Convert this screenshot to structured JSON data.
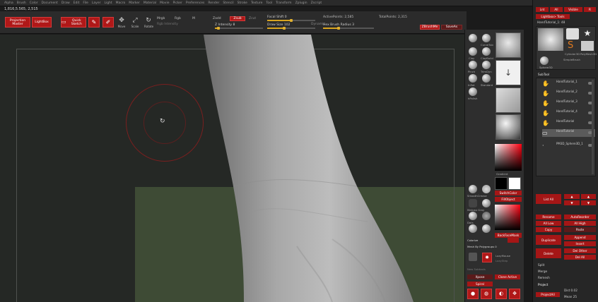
{
  "menu": [
    "Alpha",
    "Brush",
    "Color",
    "Document",
    "Draw",
    "Edit",
    "File",
    "Layer",
    "Light",
    "Macro",
    "Marker",
    "Material",
    "Movie",
    "Picker",
    "Preferences",
    "Render",
    "Stencil",
    "Stroke",
    "Texture",
    "Tool",
    "Transform",
    "Zplugin",
    "Zscript"
  ],
  "status_line": "1,816,5.565, 2,515",
  "shelf": {
    "projection_master": "Projection Master",
    "lightbox": "LightBox",
    "quick_sketch": "Quick Sketch",
    "edit": "Edit",
    "draw": "Draw",
    "move": "Move",
    "scale": "Scale",
    "rotate": "Rotate",
    "mrgb": "Mrgb",
    "rgb": "Rgb",
    "m": "M",
    "zadd": "Zadd",
    "zsub": "Zsub",
    "zcut": "Zcut",
    "rgb_intensity": "Rgb Intensity",
    "z_intensity": "Z Intensity 8",
    "focal_shift": "Focal Shift 0",
    "draw_size": "Draw Size 102",
    "dynamic": "Dynamic",
    "active_points": "ActivePoints: 2,585",
    "total_points": "TotalPoints: 2,315",
    "hex_brush": "Hex Brush Radius 3",
    "zadd_active": true,
    "zsub_active": false,
    "z_intensity_level": 0.08,
    "draw_size_level": 0.35,
    "focal_level": 0.5,
    "hex_level": 0.3,
    "zbrush_btn": "ZBrushMe",
    "tool_btn": "SaveAs"
  },
  "tray": {
    "brushes": [
      "CurveTub",
      "Clay",
      "ClayBuild",
      "Pinch",
      "TrimDyn",
      "Inflat",
      "Standard",
      "hPolish"
    ],
    "gradient": "Gradient",
    "switch_color": "SwitchColor",
    "fill_object": "FillObject",
    "alternate": "Alternate",
    "back_face_mask": "BackFaceMask",
    "colorize": "Colorize",
    "mesh_by_polygroups": "Mesh By Polygroups 0",
    "lazy_mouse": "LazyMouse",
    "lazy_step": "LazyStep",
    "new_subtools": "New Subtools",
    "clone_active": "Clone Active",
    "xpose": "Xpose",
    "spiral": "Spiral",
    "swatch_labels": [
      "Sphere",
      "Flat Color",
      "SmoothCrease",
      "Rest",
      "Matcap Gray",
      "Fast Shade",
      "Dots",
      "Zplot"
    ]
  },
  "rpanel": {
    "top_tabs": [
      "Lnt",
      "All",
      "Visible",
      "R"
    ],
    "lightbox_tools": "Lightbox> Tools",
    "tool_name": "HandTutorial_1: 48",
    "thumb_labels": [
      "HandTutorial",
      "Cylinder3D",
      "PolyMesh3D",
      "Sphere3D",
      "SimpleBrush"
    ],
    "subtool_title": "SubTool",
    "subtools": [
      "HandTutorial_1",
      "HandTutorial_2",
      "HandTutorial_3",
      "HandTutorial_4",
      "HandTutorial",
      "PM3D_Sphere3D_1"
    ],
    "list_all": "List All",
    "rename": "Rename",
    "auto_reorder": "AutoReorder",
    "all_low": "All Low",
    "all_high": "All High",
    "copy": "Copy",
    "paste": "Paste",
    "duplicate": "Duplicate",
    "append": "Append",
    "insert": "Insert",
    "delete": "Delete",
    "del_other": "Del Other",
    "del_all": "Del All",
    "split": "Split",
    "merge": "Merge",
    "remesh": "Remesh",
    "project": "Project",
    "project_all": "ProjectAll",
    "dist": "Dist 0.02",
    "mean": "Mean 25"
  },
  "colors": {
    "accent_red": "#b01818",
    "slider_gold": "#d9a520",
    "canvas": "#252825",
    "floor_green": "#3f4d36"
  }
}
